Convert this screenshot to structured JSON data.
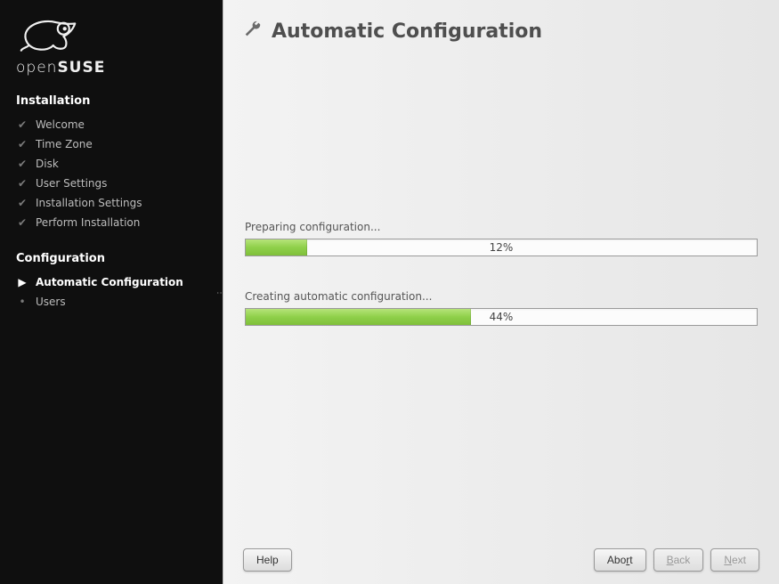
{
  "brand": {
    "open": "open",
    "suse": "SUSE"
  },
  "sidebar": {
    "section1_title": "Installation",
    "section2_title": "Configuration",
    "steps_install": [
      {
        "label": "Welcome"
      },
      {
        "label": "Time Zone"
      },
      {
        "label": "Disk"
      },
      {
        "label": "User Settings"
      },
      {
        "label": "Installation Settings"
      },
      {
        "label": "Perform Installation"
      }
    ],
    "steps_config": [
      {
        "label": "Automatic Configuration"
      },
      {
        "label": "Users"
      }
    ]
  },
  "page_title": "Automatic Configuration",
  "progress1": {
    "label": "Preparing configuration...",
    "percent": 12,
    "text": "12%"
  },
  "progress2": {
    "label": "Creating automatic configuration...",
    "percent": 44,
    "text": "44%"
  },
  "buttons": {
    "help": "Help",
    "abort": {
      "pre": "Abo",
      "ul": "r",
      "post": "t"
    },
    "back": {
      "ul": "B",
      "post": "ack"
    },
    "next": {
      "ul": "N",
      "post": "ext"
    }
  }
}
